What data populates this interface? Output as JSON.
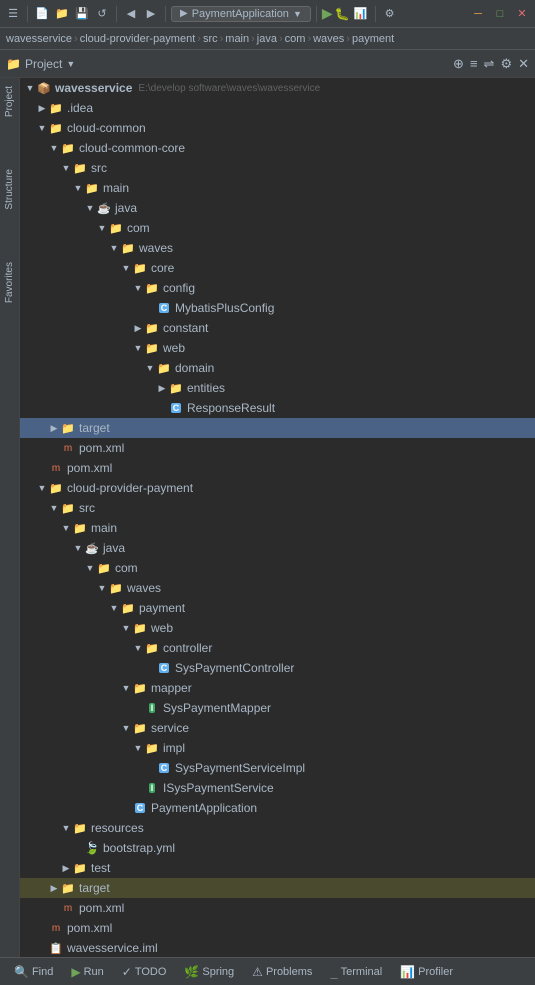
{
  "toolbar": {
    "run_config": "PaymentApplication",
    "icons": [
      "←",
      "→",
      "↺",
      "◀",
      "▶"
    ]
  },
  "breadcrumb": {
    "items": [
      "wavesservice",
      "cloud-provider-payment",
      "src",
      "main",
      "java",
      "com",
      "waves",
      "payment"
    ]
  },
  "panel": {
    "title": "Project",
    "view_label": "Project"
  },
  "tree": {
    "root_label": "wavesservice",
    "root_path": "E:\\develop software\\waves\\wavesservice",
    "items": [
      {
        "id": "idea",
        "label": ".idea",
        "type": "folder",
        "indent": 1,
        "expanded": false,
        "arrow": "▶"
      },
      {
        "id": "cloud-common",
        "label": "cloud-common",
        "type": "folder-module",
        "indent": 1,
        "expanded": true,
        "arrow": "▼"
      },
      {
        "id": "cloud-common-core",
        "label": "cloud-common-core",
        "type": "folder-module",
        "indent": 2,
        "expanded": true,
        "arrow": "▼"
      },
      {
        "id": "src1",
        "label": "src",
        "type": "folder-src",
        "indent": 3,
        "expanded": true,
        "arrow": "▼"
      },
      {
        "id": "main1",
        "label": "main",
        "type": "folder",
        "indent": 4,
        "expanded": true,
        "arrow": "▼"
      },
      {
        "id": "java1",
        "label": "java",
        "type": "folder-blue",
        "indent": 5,
        "expanded": true,
        "arrow": "▼"
      },
      {
        "id": "com1",
        "label": "com",
        "type": "folder",
        "indent": 6,
        "expanded": true,
        "arrow": "▼"
      },
      {
        "id": "waves1",
        "label": "waves",
        "type": "folder",
        "indent": 7,
        "expanded": true,
        "arrow": "▼"
      },
      {
        "id": "core1",
        "label": "core",
        "type": "folder",
        "indent": 8,
        "expanded": true,
        "arrow": "▼"
      },
      {
        "id": "config1",
        "label": "config",
        "type": "folder",
        "indent": 9,
        "expanded": true,
        "arrow": "▼"
      },
      {
        "id": "mybatisplusconfig",
        "label": "MybatisPlusConfig",
        "type": "class",
        "indent": 10,
        "expanded": false,
        "arrow": ""
      },
      {
        "id": "constant1",
        "label": "constant",
        "type": "folder",
        "indent": 9,
        "expanded": false,
        "arrow": "▶"
      },
      {
        "id": "web1",
        "label": "web",
        "type": "folder",
        "indent": 9,
        "expanded": true,
        "arrow": "▼"
      },
      {
        "id": "domain1",
        "label": "domain",
        "type": "folder",
        "indent": 10,
        "expanded": true,
        "arrow": "▼"
      },
      {
        "id": "entities1",
        "label": "entities",
        "type": "folder",
        "indent": 11,
        "expanded": false,
        "arrow": "▶"
      },
      {
        "id": "responseresult",
        "label": "ResponseResult",
        "type": "class",
        "indent": 11,
        "expanded": false,
        "arrow": ""
      },
      {
        "id": "target1",
        "label": "target",
        "type": "folder-orange",
        "indent": 2,
        "expanded": false,
        "arrow": "▶",
        "selected": true
      },
      {
        "id": "pom1",
        "label": "pom.xml",
        "type": "xml",
        "indent": 2,
        "expanded": false,
        "arrow": ""
      },
      {
        "id": "pom-root",
        "label": "pom.xml",
        "type": "xml",
        "indent": 1,
        "expanded": false,
        "arrow": ""
      },
      {
        "id": "cloud-provider-payment",
        "label": "cloud-provider-payment",
        "type": "folder-module",
        "indent": 1,
        "expanded": true,
        "arrow": "▼"
      },
      {
        "id": "src2",
        "label": "src",
        "type": "folder-src",
        "indent": 2,
        "expanded": true,
        "arrow": "▼"
      },
      {
        "id": "main2",
        "label": "main",
        "type": "folder",
        "indent": 3,
        "expanded": true,
        "arrow": "▼"
      },
      {
        "id": "java2",
        "label": "java",
        "type": "folder-blue",
        "indent": 4,
        "expanded": true,
        "arrow": "▼"
      },
      {
        "id": "com2",
        "label": "com",
        "type": "folder",
        "indent": 5,
        "expanded": true,
        "arrow": "▼"
      },
      {
        "id": "waves2",
        "label": "waves",
        "type": "folder",
        "indent": 6,
        "expanded": true,
        "arrow": "▼"
      },
      {
        "id": "payment2",
        "label": "payment",
        "type": "folder",
        "indent": 7,
        "expanded": true,
        "arrow": "▼"
      },
      {
        "id": "web2",
        "label": "web",
        "type": "folder",
        "indent": 8,
        "expanded": true,
        "arrow": "▼"
      },
      {
        "id": "controller2",
        "label": "controller",
        "type": "folder",
        "indent": 9,
        "expanded": true,
        "arrow": "▼"
      },
      {
        "id": "syspaymentcontroller",
        "label": "SysPaymentController",
        "type": "class",
        "indent": 10,
        "expanded": false,
        "arrow": ""
      },
      {
        "id": "mapper2",
        "label": "mapper",
        "type": "folder",
        "indent": 8,
        "expanded": true,
        "arrow": "▼"
      },
      {
        "id": "syspaymentmapper",
        "label": "SysPaymentMapper",
        "type": "interface",
        "indent": 9,
        "expanded": false,
        "arrow": ""
      },
      {
        "id": "service2",
        "label": "service",
        "type": "folder",
        "indent": 8,
        "expanded": true,
        "arrow": "▼"
      },
      {
        "id": "impl2",
        "label": "impl",
        "type": "folder",
        "indent": 9,
        "expanded": true,
        "arrow": "▼"
      },
      {
        "id": "syspaymentserviceimpl",
        "label": "SysPaymentServiceImpl",
        "type": "class",
        "indent": 10,
        "expanded": false,
        "arrow": ""
      },
      {
        "id": "isyspaymentservice",
        "label": "ISysPaymentService",
        "type": "interface",
        "indent": 9,
        "expanded": false,
        "arrow": ""
      },
      {
        "id": "paymentapplication",
        "label": "PaymentApplication",
        "type": "class",
        "indent": 8,
        "expanded": false,
        "arrow": ""
      },
      {
        "id": "resources2",
        "label": "resources",
        "type": "folder",
        "indent": 3,
        "expanded": true,
        "arrow": "▼"
      },
      {
        "id": "bootstrap",
        "label": "bootstrap.yml",
        "type": "yml",
        "indent": 4,
        "expanded": false,
        "arrow": ""
      },
      {
        "id": "test2",
        "label": "test",
        "type": "folder",
        "indent": 3,
        "expanded": false,
        "arrow": "▶"
      },
      {
        "id": "target2",
        "label": "target",
        "type": "folder-orange",
        "indent": 2,
        "expanded": false,
        "arrow": "▶",
        "highlighted": true
      },
      {
        "id": "pom2",
        "label": "pom.xml",
        "type": "xml",
        "indent": 2,
        "expanded": false,
        "arrow": ""
      },
      {
        "id": "pom3",
        "label": "pom.xml",
        "type": "xml",
        "indent": 1,
        "expanded": false,
        "arrow": ""
      },
      {
        "id": "wavesservice-iml",
        "label": "wavesservice.iml",
        "type": "iml",
        "indent": 1,
        "expanded": false,
        "arrow": ""
      }
    ]
  },
  "bottom_tabs": [
    {
      "id": "find",
      "label": "Find",
      "icon": "🔍"
    },
    {
      "id": "run",
      "label": "Run",
      "icon": "▶"
    },
    {
      "id": "todo",
      "label": "TODO",
      "icon": "✓"
    },
    {
      "id": "spring",
      "label": "Spring",
      "icon": "🌿"
    },
    {
      "id": "problems",
      "label": "Problems",
      "icon": "⚠"
    },
    {
      "id": "terminal",
      "label": "Terminal",
      "icon": ">_"
    },
    {
      "id": "profiler",
      "label": "Profiler",
      "icon": "📊"
    }
  ],
  "left_panels": [
    "Project",
    "Structure",
    "Favorites"
  ],
  "colors": {
    "selected_bg": "#4a6285",
    "highlighted_bg": "#4a4a2e",
    "folder_orange": "#e8a24a",
    "folder_blue": "#6897bb",
    "class_color": "#61afef",
    "interface_color": "#3da862"
  }
}
